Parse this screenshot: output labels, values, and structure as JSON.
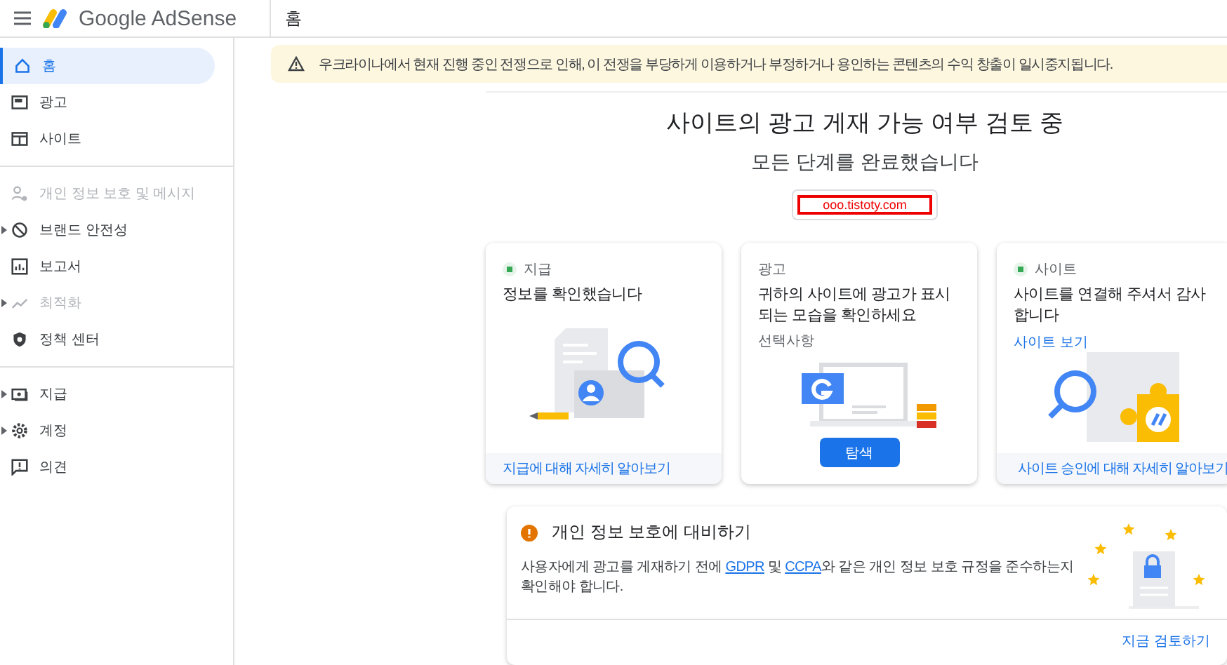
{
  "header": {
    "app_name": "Google AdSense",
    "page_title": "홈"
  },
  "sidebar": {
    "groups": [
      [
        {
          "label": "홈",
          "selected": true,
          "disabled": false,
          "expandable": false
        },
        {
          "label": "광고",
          "selected": false,
          "disabled": false,
          "expandable": false
        },
        {
          "label": "사이트",
          "selected": false,
          "disabled": false,
          "expandable": false
        }
      ],
      [
        {
          "label": "개인 정보 보호 및 메시지",
          "selected": false,
          "disabled": true,
          "expandable": false
        },
        {
          "label": "브랜드 안전성",
          "selected": false,
          "disabled": false,
          "expandable": true
        },
        {
          "label": "보고서",
          "selected": false,
          "disabled": false,
          "expandable": false
        },
        {
          "label": "최적화",
          "selected": false,
          "disabled": true,
          "expandable": true
        },
        {
          "label": "정책 센터",
          "selected": false,
          "disabled": false,
          "expandable": false
        }
      ],
      [
        {
          "label": "지급",
          "selected": false,
          "disabled": false,
          "expandable": true
        },
        {
          "label": "계정",
          "selected": false,
          "disabled": false,
          "expandable": true
        },
        {
          "label": "의견",
          "selected": false,
          "disabled": false,
          "expandable": false
        }
      ]
    ]
  },
  "banner": {
    "text": "우크라이나에서 현재 진행 중인 전쟁으로 인해, 이 전쟁을 부당하게 이용하거나 부정하거나 용인하는 콘텐츠의 수익 창출이 일시중지됩니다."
  },
  "review": {
    "title": "사이트의 광고 게재 가능 여부 검토 중",
    "subtitle": "모든 단계를 완료했습니다",
    "site_url": "ooo.tistoty.com"
  },
  "cards": [
    {
      "category": "지급",
      "done": true,
      "title": "정보를 확인했습니다",
      "footer_link": "지급에 대해 자세히 알아보기"
    },
    {
      "category": "광고",
      "done": false,
      "title": "귀하의 사이트에 광고가 표시되는 모습을 확인하세요",
      "note": "선택사항",
      "action": "탐색"
    },
    {
      "category": "사이트",
      "done": true,
      "title": "사이트를 연결해 주셔서 감사합니다",
      "link": "사이트 보기",
      "footer_link": "사이트 승인에 대해 자세히 알아보기"
    }
  ],
  "privacy": {
    "title": "개인 정보 보호에 대비하기",
    "body": [
      {
        "text": "사용자에게 광고를 게재하기 전에 ",
        "link": false
      },
      {
        "text": "GDPR",
        "link": true
      },
      {
        "text": " 및 ",
        "link": false
      },
      {
        "text": "CCPA",
        "link": true
      },
      {
        "text": "와 같은 개인 정보 보호 규정을 준수하는지 확인해야 합니다.",
        "link": false
      }
    ],
    "action": "지금 검토하기"
  }
}
